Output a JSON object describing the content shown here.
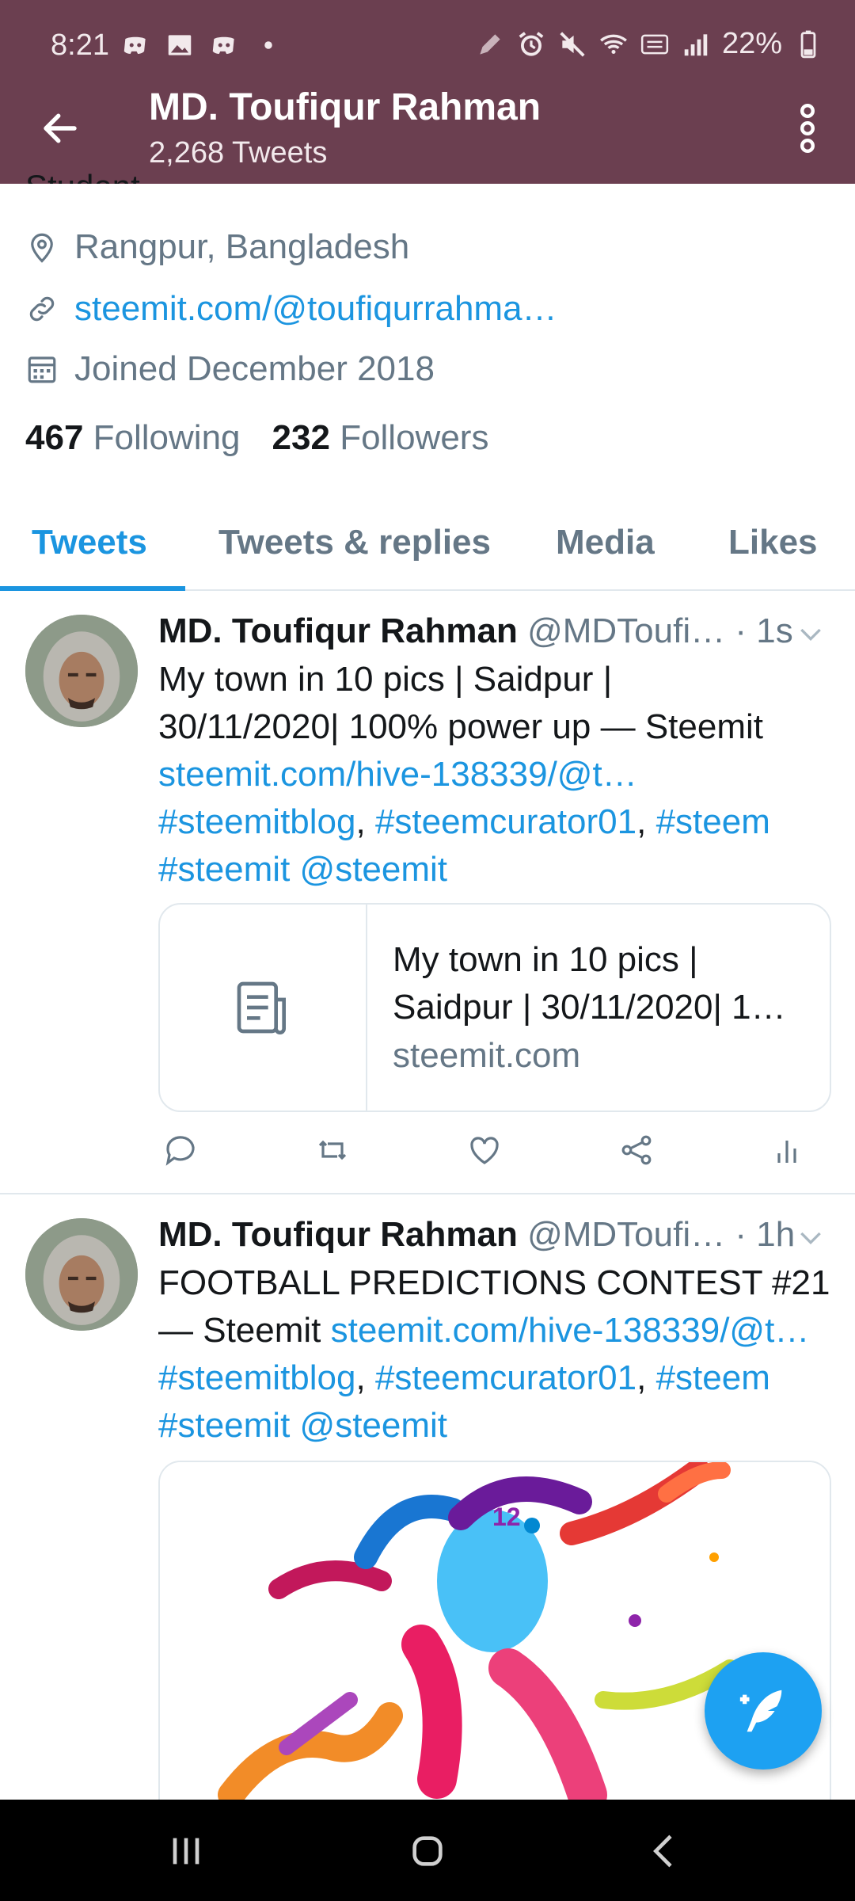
{
  "status_bar": {
    "time": "8:21",
    "battery": "22%",
    "icons_left": [
      "discord-icon",
      "gallery-icon",
      "discord-icon",
      "dot-icon"
    ],
    "icons_right": [
      "pen-icon",
      "alarm-icon",
      "mute-icon",
      "wifi-icon",
      "volte-icon",
      "signal-icon",
      "battery-icon"
    ]
  },
  "header": {
    "title": "MD. Toufiqur Rahman",
    "subtitle": "2,268 Tweets"
  },
  "profile": {
    "bio_cut": "Student",
    "location": "Rangpur, Bangladesh",
    "website": "steemit.com/@toufiqurrahma…",
    "joined": "Joined December 2018",
    "following_count": "467",
    "following_label": "Following",
    "followers_count": "232",
    "followers_label": "Followers"
  },
  "tabs": [
    {
      "label": "Tweets",
      "active": true
    },
    {
      "label": "Tweets & replies",
      "active": false
    },
    {
      "label": "Media",
      "active": false
    },
    {
      "label": "Likes",
      "active": false
    }
  ],
  "tweets": [
    {
      "name": "MD. Toufiqur Rahman",
      "handle": "@MDToufi…",
      "time": "· 1s",
      "text_line1": "My town in 10 pics | Saidpur |",
      "text_line2": "30/11/2020| 100% power up — Steemit",
      "link": "steemit.com/hive-138339/@t…",
      "tags": {
        "a": "#steemitblog",
        "sep1": ", ",
        "b": "#steemcurator01",
        "sep2": ", ",
        "c": "#steem",
        "d": "#steemit",
        "e": "@steemit"
      },
      "card": {
        "title_line1": "My town in 10 pics |",
        "title_line2": "Saidpur | 30/11/2020| 1…",
        "domain": "steemit.com"
      }
    },
    {
      "name": "MD. Toufiqur Rahman",
      "handle": "@MDToufi…",
      "time": "· 1h",
      "text_line1": "FOOTBALL PREDICTIONS CONTEST #21",
      "text_line2_prefix": "— Steemit ",
      "link": "steemit.com/hive-138339/@t…",
      "tags": {
        "a": "#steemitblog",
        "sep1": ", ",
        "b": "#steemcurator01",
        "sep2": ", ",
        "c": "#steem",
        "d": "#steemit",
        "e": "@steemit"
      },
      "media_label": "12"
    }
  ],
  "colors": {
    "header_bg": "#6b3f50",
    "accent": "#1b95e0",
    "fab": "#1da1f2"
  }
}
